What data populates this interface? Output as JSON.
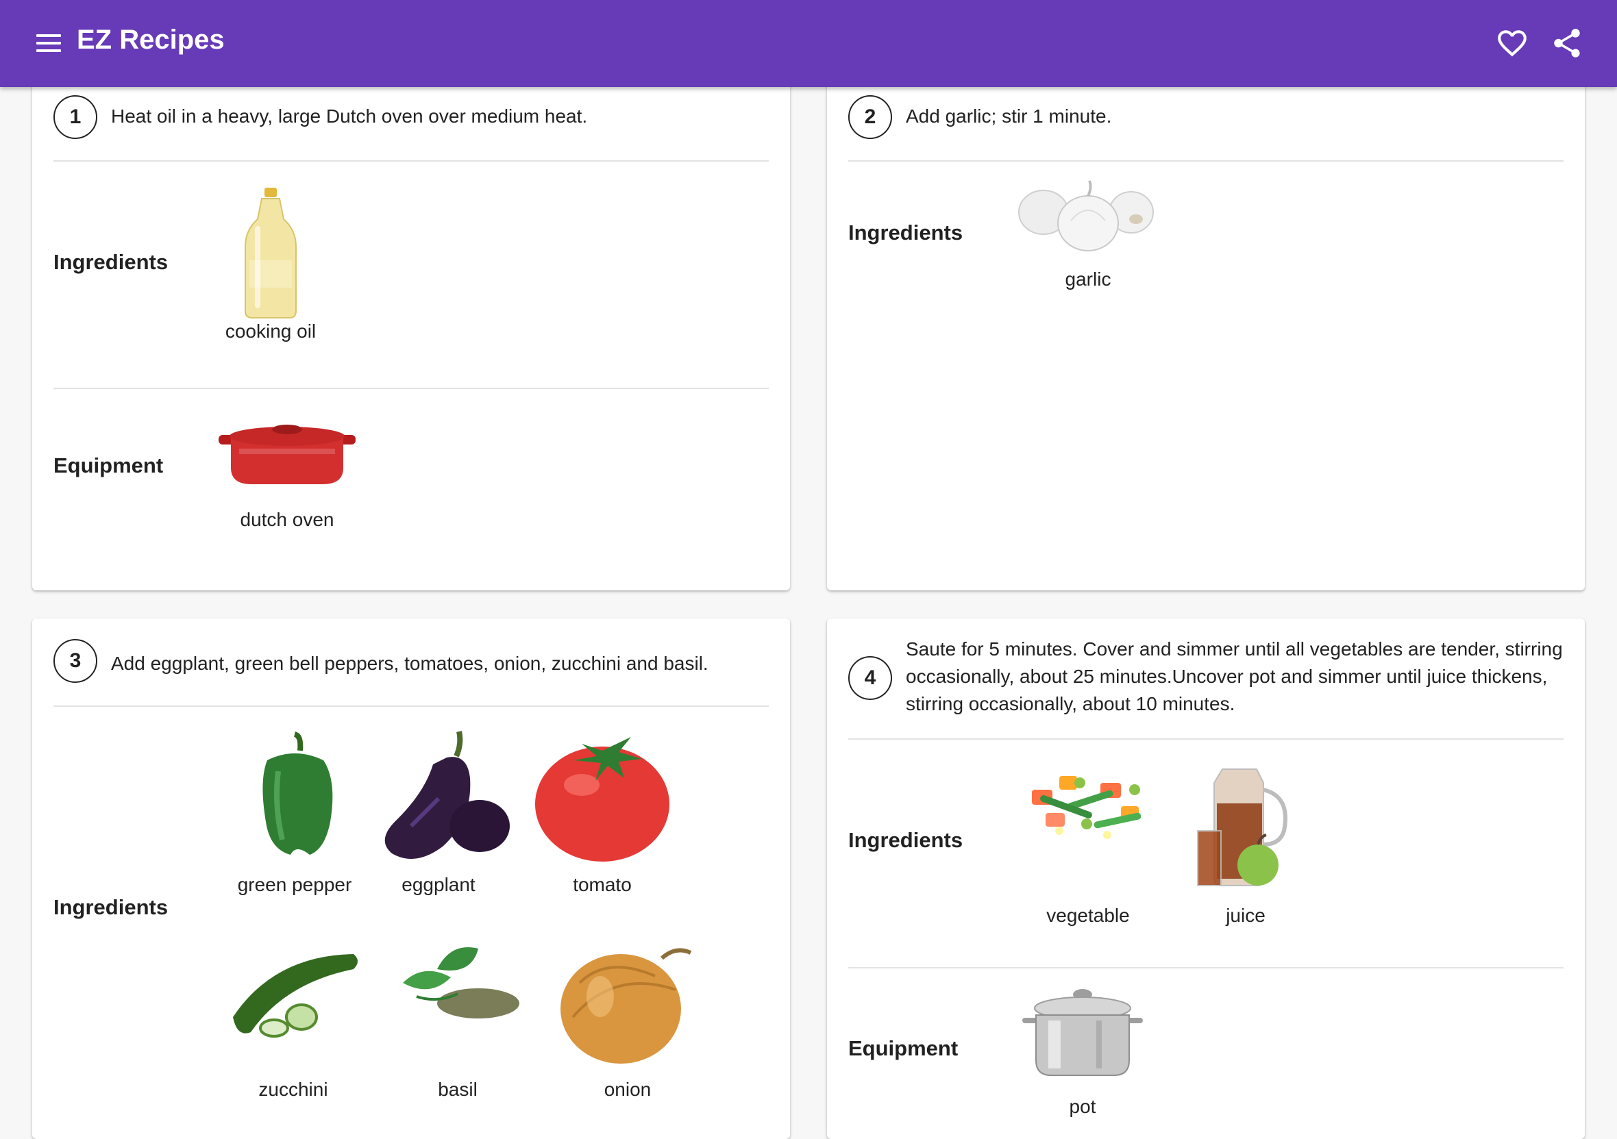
{
  "app": {
    "title": "EZ Recipes",
    "colors": {
      "primary": "#673ab7"
    },
    "icons": {
      "menu": "menu-icon",
      "favorite": "heart-outline-icon",
      "share": "share-icon"
    }
  },
  "labels": {
    "ingredients": "Ingredients",
    "equipment": "Equipment"
  },
  "steps": [
    {
      "number": "1",
      "text": "Heat oil in a heavy, large Dutch oven over medium heat.",
      "ingredients": [
        "cooking oil"
      ],
      "equipment": [
        "dutch oven"
      ]
    },
    {
      "number": "2",
      "text": "Add garlic; stir 1 minute.",
      "ingredients": [
        "garlic"
      ],
      "equipment": []
    },
    {
      "number": "3",
      "text": "Add eggplant, green bell peppers, tomatoes, onion, zucchini and basil.",
      "ingredients": [
        "green pepper",
        "eggplant",
        "tomato",
        "zucchini",
        "basil",
        "onion"
      ],
      "equipment": []
    },
    {
      "number": "4",
      "text": "Saute for 5 minutes. Cover and simmer until all vegetables are tender, stirring occasionally, about 25 minutes.Uncover pot and simmer until juice thickens, stirring occasionally, about 10 minutes.",
      "ingredients": [
        "vegetable",
        "juice"
      ],
      "equipment": [
        "pot"
      ]
    }
  ]
}
